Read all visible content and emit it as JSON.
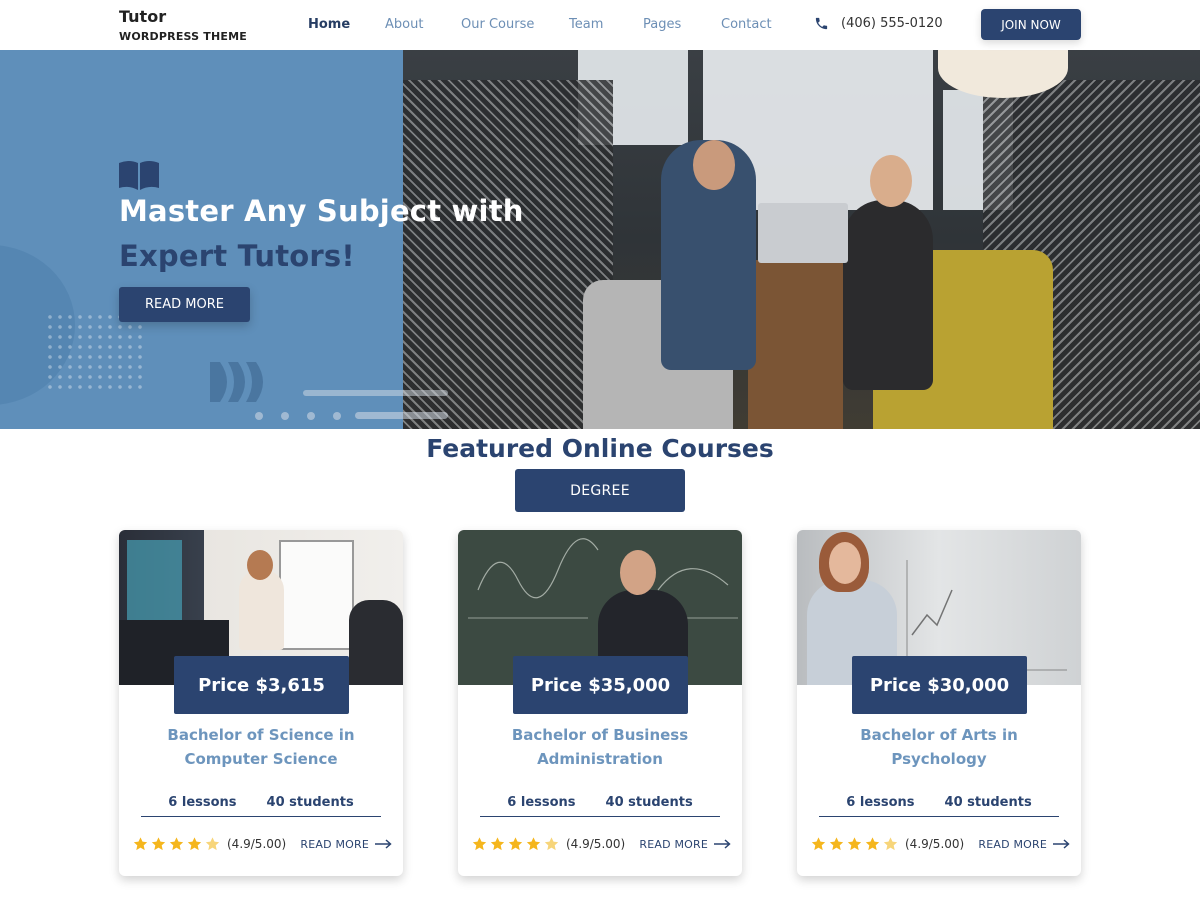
{
  "header": {
    "logo_title": "Tutor",
    "logo_subtitle": "WORDPRESS THEME",
    "nav": [
      {
        "label": "Home",
        "active": true
      },
      {
        "label": "About",
        "active": false
      },
      {
        "label": "Our Course",
        "active": false
      },
      {
        "label": "Team",
        "active": false
      },
      {
        "label": "Pages",
        "active": false
      },
      {
        "label": "Contact",
        "active": false
      }
    ],
    "phone": "(406) 555-0120",
    "join_label": "JOIN NOW"
  },
  "hero": {
    "title_line1": "Master Any Subject with",
    "title_line2": "Expert Tutors!",
    "button_label": "READ MORE",
    "icon": "open-book-icon"
  },
  "courses": {
    "section_title": "Featured Online Courses",
    "filter_label": "DEGREE",
    "cards": [
      {
        "price": "Price $3,615",
        "title": "Bachelor of Science in Computer Science",
        "lessons": "6 lessons",
        "students": "40 students",
        "rating_text": "(4.9/5.00)",
        "rating_value": 4.5,
        "read_more": "READ MORE"
      },
      {
        "price": "Price $35,000",
        "title": "Bachelor of Business Administration",
        "lessons": "6 lessons",
        "students": "40 students",
        "rating_text": "(4.9/5.00)",
        "rating_value": 4.5,
        "read_more": "READ MORE"
      },
      {
        "price": "Price $30,000",
        "title": "Bachelor of Arts in Psychology",
        "lessons": "6 lessons",
        "students": "40 students",
        "rating_text": "(4.9/5.00)",
        "rating_value": 4.5,
        "read_more": "READ MORE"
      }
    ]
  },
  "colors": {
    "primary": "#2b4470",
    "hero_blue": "#5f8fba",
    "accent_light": "#6d95bd",
    "star": "#f5b61d"
  }
}
